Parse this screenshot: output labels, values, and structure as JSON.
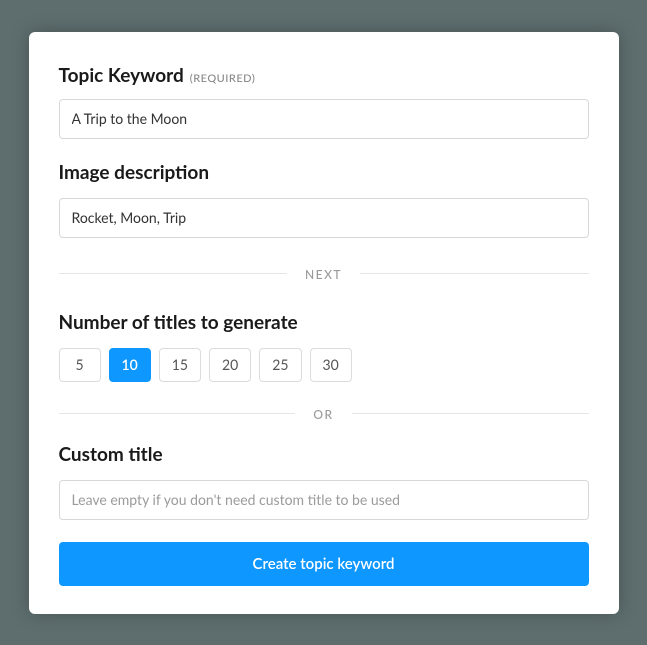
{
  "topic": {
    "label": "Topic Keyword",
    "required_tag": "(REQUIRED)",
    "value": "A Trip to the Moon"
  },
  "image_desc": {
    "label": "Image description",
    "value": "Rocket, Moon, Trip"
  },
  "divider_next": "NEXT",
  "titles_count": {
    "label": "Number of titles to generate",
    "options": [
      "5",
      "10",
      "15",
      "20",
      "25",
      "30"
    ],
    "selected": "10"
  },
  "divider_or": "OR",
  "custom_title": {
    "label": "Custom title",
    "placeholder": "Leave empty if you don't need custom title to be used",
    "value": ""
  },
  "submit_label": "Create topic keyword"
}
